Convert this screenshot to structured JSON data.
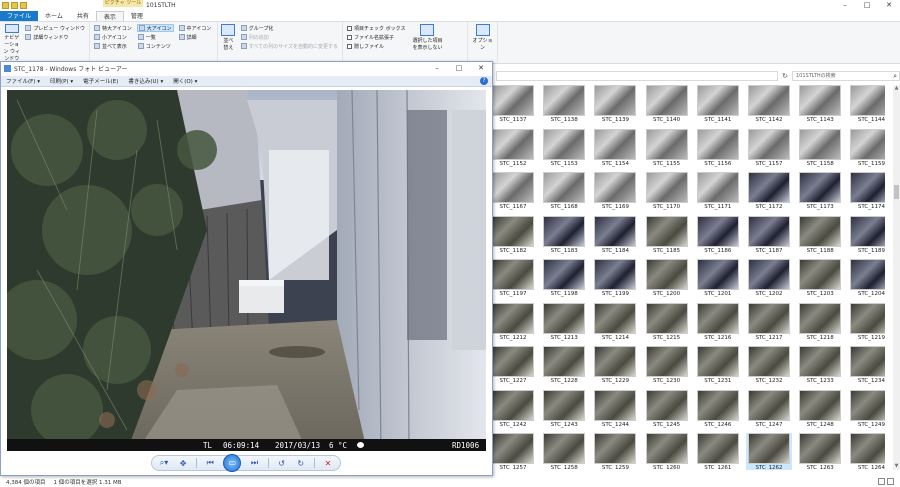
{
  "explorer": {
    "context_tab": "ピクチャ ツール",
    "window_title": "101STLTH",
    "tabs": [
      "ファイル",
      "ホーム",
      "共有",
      "表示",
      "管理"
    ],
    "ribbon": {
      "nav_pane": "ナビゲーション ウィンドウ",
      "preview_pane": "プレビュー ウィンドウ",
      "details_pane": "詳細ウィンドウ",
      "layout_items": [
        "特大アイコン",
        "大アイコン",
        "中アイコン",
        "小アイコン",
        "一覧",
        "詳細",
        "並べて表示",
        "コンテンツ"
      ],
      "sort": "並べ替え",
      "group_by": "グループ化",
      "add_columns": "列の追加",
      "fit_columns": "すべての列のサイズを自動的に変更する",
      "item_checkbox": "項目チェック ボックス",
      "file_ext": "ファイル名拡張子",
      "hidden_items": "隠しファイル",
      "hide_selected": "選択した項目を表示しない",
      "options": "オプション"
    },
    "search_placeholder": "101STLTHの検索",
    "thumbnails": [
      "STC_1137",
      "STC_1138",
      "STC_1139",
      "STC_1140",
      "STC_1141",
      "STC_1142",
      "STC_1143",
      "STC_1144",
      "STC_1152",
      "STC_1153",
      "STC_1154",
      "STC_1155",
      "STC_1156",
      "STC_1157",
      "STC_1158",
      "STC_1159",
      "STC_1167",
      "STC_1168",
      "STC_1169",
      "STC_1170",
      "STC_1171",
      "STC_1172",
      "STC_1173",
      "STC_1174",
      "STC_1182",
      "STC_1183",
      "STC_1184",
      "STC_1185",
      "STC_1186",
      "STC_1187",
      "STC_1188",
      "STC_1189",
      "STC_1197",
      "STC_1198",
      "STC_1199",
      "STC_1200",
      "STC_1201",
      "STC_1202",
      "STC_1203",
      "STC_1204",
      "STC_1212",
      "STC_1213",
      "STC_1214",
      "STC_1215",
      "STC_1216",
      "STC_1217",
      "STC_1218",
      "STC_1219",
      "STC_1227",
      "STC_1228",
      "STC_1229",
      "STC_1230",
      "STC_1231",
      "STC_1232",
      "STC_1233",
      "STC_1234",
      "STC_1242",
      "STC_1243",
      "STC_1244",
      "STC_1245",
      "STC_1246",
      "STC_1247",
      "STC_1248",
      "STC_1249",
      "STC_1257",
      "STC_1258",
      "STC_1259",
      "STC_1260",
      "STC_1261",
      "STC_1262",
      "STC_1263",
      "STC_1264"
    ],
    "selected_thumbnail": "STC_1262",
    "status": {
      "count": "4,384 個の項目",
      "selected": "1 個の項目を選択 1.31 MB"
    }
  },
  "viewer": {
    "title": "STC_1178 - Windows フォト ビューアー",
    "menu": [
      "ファイル(F) ▾",
      "印刷(P) ▾",
      "電子メール(E)",
      "書き込み(U) ▾",
      "開く(O) ▾"
    ],
    "osd": {
      "mode": "TL",
      "time": "06:09:14",
      "date": "2017/03/13",
      "temp": "6 °C",
      "camera": "RD1006"
    }
  }
}
